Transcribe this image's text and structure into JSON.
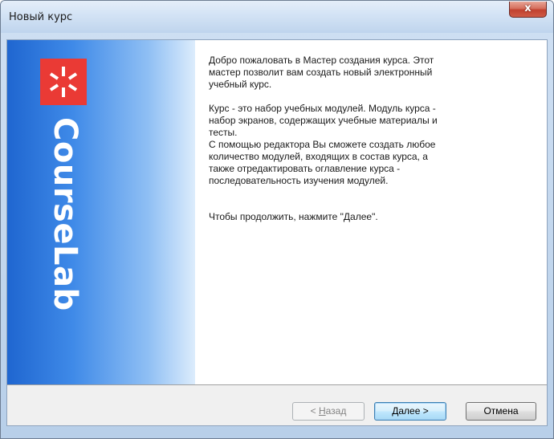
{
  "window": {
    "title": "Новый курс",
    "close_glyph": "x"
  },
  "banner": {
    "brand_text": "CourseLab",
    "logo_color": "#ea3a35",
    "gradient_dark": "#1f66d0",
    "gradient_light": "#dcecfc"
  },
  "content": {
    "paragraph1": "Добро пожаловать в Мастер создания курса. Этот\nмастер позволит вам создать новый электронный\nучебный курс.",
    "paragraph2": "Курс - это набор учебных модулей. Модуль курса -\nнабор экранов, содержащих учебные материалы и\nтесты.\nС помощью редактора Вы сможете создать любое\nколичество модулей, входящих в состав курса, а\nтакже отредактировать оглавление курса  -\nпоследовательность изучения модулей.",
    "paragraph3": "Чтобы продолжить, нажмите \"Далее\"."
  },
  "buttons": {
    "back_prefix": "< ",
    "back_accel": "Н",
    "back_rest": "азад",
    "next_label": "Далее >",
    "cancel_label": "Отмена"
  }
}
